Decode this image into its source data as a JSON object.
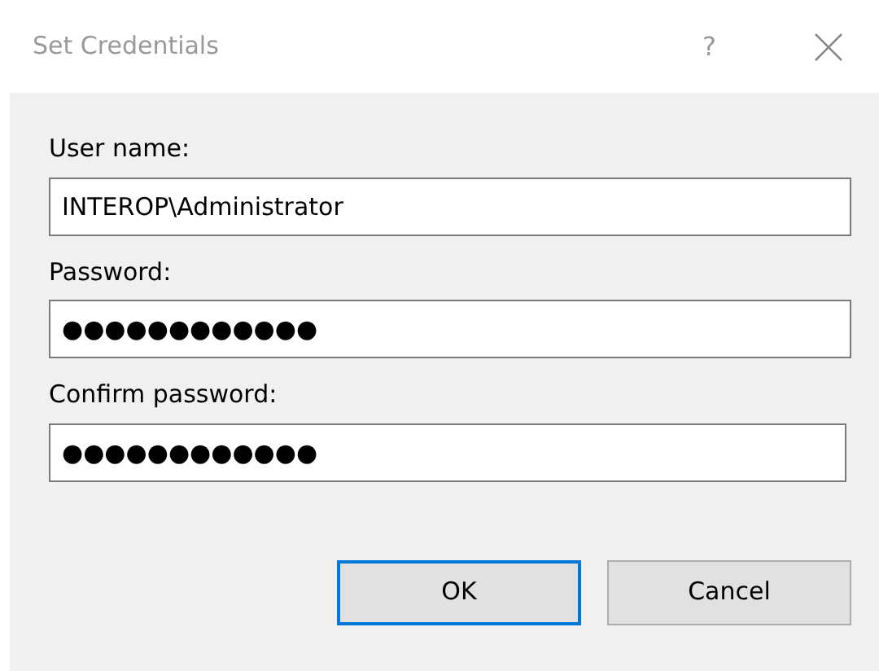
{
  "window": {
    "title": "Set Credentials",
    "help": "?"
  },
  "fields": [
    {
      "label": "User name:",
      "value": "INTEROP\\Administrator"
    },
    {
      "label": "Password:",
      "value": "●●●●●●●●●●●●"
    },
    {
      "label": "Confirm password:",
      "value": "●●●●●●●●●●●●"
    }
  ],
  "buttons": [
    {
      "label": "OK",
      "default": true
    },
    {
      "label": "Cancel",
      "default": false
    }
  ]
}
